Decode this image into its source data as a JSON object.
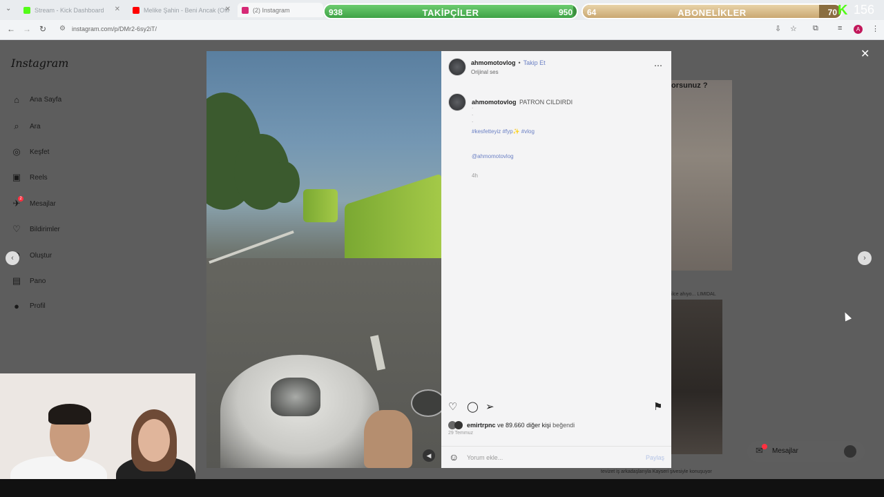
{
  "browser": {
    "tabs": [
      {
        "title": "Stream - Kick Dashboard",
        "favicon_color": "#53fc18"
      },
      {
        "title": "Melike Şahin - Beni Ancak (Offi",
        "favicon_color": "#ff0000"
      },
      {
        "title": "(2) Instagram",
        "favicon_color": "#d62976"
      }
    ],
    "url": "instagram.com/p/DMr2-6sy2iT/",
    "profile_initial": "A"
  },
  "overlay": {
    "followers": {
      "label": "TAKİPÇİLER",
      "current": "938",
      "goal": "950",
      "progress": 0.987,
      "color": "#4caf50"
    },
    "subscribers": {
      "label": "ABONELİKLER",
      "current": "64",
      "goal": "70",
      "progress": 0.914,
      "color": "#d9bd8c"
    },
    "viewers": "156"
  },
  "sidebar": {
    "logo": "Instagram",
    "items": [
      {
        "label": "Ana Sayfa",
        "icon": "home-icon"
      },
      {
        "label": "Ara",
        "icon": "search-icon"
      },
      {
        "label": "Keşfet",
        "icon": "compass-icon"
      },
      {
        "label": "Reels",
        "icon": "reels-icon"
      },
      {
        "label": "Mesajlar",
        "icon": "messenger-icon",
        "badge": "2"
      },
      {
        "label": "Bildirimler",
        "icon": "heart-icon"
      },
      {
        "label": "Oluştur",
        "icon": "plus-icon"
      },
      {
        "label": "Pano",
        "icon": "dashboard-icon"
      },
      {
        "label": "Profil",
        "icon": "avatar-icon"
      }
    ]
  },
  "background": {
    "thumb_caption": "orsunuz ?",
    "snippet1": "ilce ahıyo... LIMIDAL",
    "snippet2": "tevizet iş arkadaşlarıyla Kayseri şivesiyle konuşuyor"
  },
  "post": {
    "username": "ahmomotovlog",
    "follow_label": "Takip Et",
    "audio": "Orijinal ses",
    "caption_user": "ahmomotovlog",
    "caption": "PATRON CILDIRDI",
    "dots": [
      ".",
      ".",
      "."
    ],
    "hashtags": "#kesfetteyiz #fyp✨ #vlog",
    "mention": "@ahmomotovlog",
    "time": "4h",
    "liked_by_user": "emirtrpnc",
    "liked_by_rest": "ve 89.660 diğer kişi",
    "liked_suffix": "beğendi",
    "date": "29 Temmuz",
    "comment_placeholder": "Yorum ekle...",
    "share_label": "Paylaş"
  },
  "messages_chip": {
    "label": "Mesajlar",
    "badge": "2"
  }
}
